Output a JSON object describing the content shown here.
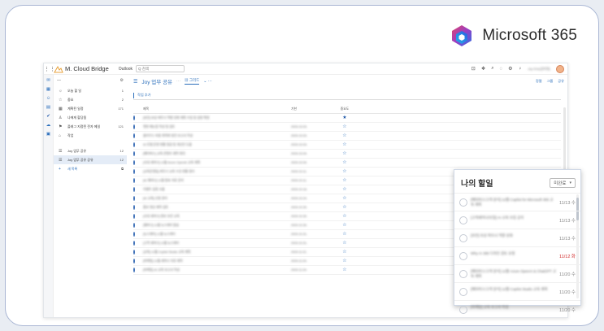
{
  "brand": {
    "name": "Microsoft 365"
  },
  "topbar": {
    "app_name": "M. Cloud Bridge",
    "outlook_label": "Outlook",
    "search_placeholder": "Q 검색",
    "user_name": "Joy Kim(김미정)"
  },
  "sidebar": {
    "items": [
      {
        "icon": "sun-icon",
        "label": "오늘 할 일",
        "count": "1"
      },
      {
        "icon": "star-icon",
        "label": "중요",
        "count": "2"
      },
      {
        "icon": "calendar-icon",
        "label": "계획된 일정",
        "count": "171"
      },
      {
        "icon": "person-icon",
        "label": "나에게 할당됨",
        "count": ""
      },
      {
        "icon": "flag-icon",
        "label": "플래그 지정된 전자 메일",
        "count": "121"
      },
      {
        "icon": "home-icon",
        "label": "작업",
        "count": ""
      }
    ],
    "lists": [
      {
        "icon": "list-icon",
        "label": "Joy 업무 공유",
        "count": "12"
      },
      {
        "icon": "list-icon",
        "label": "Joy 업무 공유 공유",
        "count": "12"
      }
    ],
    "new_list_label": "새 목록"
  },
  "main": {
    "title": "Joy 업무 공유",
    "tab_grid": "그리드",
    "actions": [
      "정렬",
      "그룹",
      "공유"
    ],
    "add_task_label": "작업 추가",
    "columns": {
      "title": "제목",
      "date": "기한",
      "importance": "중요도"
    },
    "rows": [
      {
        "title": "[보안] 보상 파트너 역량 강화 계획 수립 및 일정 확정",
        "date": "",
        "star": true
      },
      {
        "title": "챗봇 매뉴얼 작성 및 검토",
        "date": "2024.10.03.",
        "star": false
      },
      {
        "title": "클라우드 비용 최적화 방안 보고서 작성",
        "date": "2024.10.03.",
        "star": false
      },
      {
        "title": "AI 모델 운영 현황 점검 및 개선안 도출",
        "date": "2024.10.03.",
        "star": false
      },
      {
        "title": "[메타버스] 교육 콘텐츠 제작 회의",
        "date": "2024.10.04.",
        "star": false
      },
      {
        "title": "[사내 세미나] 11월 Azure OpenAI 교육 계획",
        "date": "2024.10.04.",
        "star": false
      },
      {
        "title": "[교육운영팀] 파트너 교육 수강 현황 정리",
        "date": "2024.10.11.",
        "star": false
      },
      {
        "title": "[AI 웨비나] 11월 발표 자료 준비",
        "date": "2024.10.11.",
        "star": false
      },
      {
        "title": "이벤트 일정 조율",
        "date": "2024.10.18.",
        "star": false
      },
      {
        "title": "[AI 교육] 신청 관리",
        "date": "2024.10.24.",
        "star": false
      },
      {
        "title": "홍보 영상 제작 검토",
        "date": "2024.10.30.",
        "star": false
      },
      {
        "title": "[사내 세미나] 정보 보안 교육",
        "date": "2024.10.30.",
        "star": false
      },
      {
        "title": "[웨비나] 11월 뉴스레터 발송",
        "date": "2024.10.30.",
        "star": false
      },
      {
        "title": "[뉴스레터] 11월 뉴스레터",
        "date": "2024.10.31.",
        "star": false
      },
      {
        "title": "[고객 세미나] 11월 뉴스레터",
        "date": "2024.10.31.",
        "star": false
      },
      {
        "title": "[교육] 11월 Copilot Studio 교육 계획",
        "date": "2024.11.01.",
        "star": false
      },
      {
        "title": "[마케팅] 11월 세미나 자료 제작",
        "date": "2024.11.04.",
        "star": false
      },
      {
        "title": "[마케팅] AI 교육 보고서 작성",
        "date": "2024.11.04.",
        "star": false
      }
    ]
  },
  "todo": {
    "title": "나의 할일",
    "filter_label": "미완료",
    "items": [
      {
        "text": "[메타버스/고객 분석] 12월 Copilot for Microsoft 365 교육 계획",
        "due": "11/13 수",
        "overdue": false
      },
      {
        "text": "[고객세미나/모집] AI 교육 모집 공지",
        "due": "11/13 수",
        "overdue": false
      },
      {
        "text": "[보안] 보상 파트너 역량 강화",
        "due": "11/13 수",
        "overdue": false
      },
      {
        "text": "Why AI 365 디자인 검토 요청",
        "due": "11/12 화",
        "overdue": true
      },
      {
        "text": "[메타버스/고객 분석] 12월 Azure OpenAI & ChatGPT 교육 계획",
        "due": "11/20 수",
        "overdue": false
      },
      {
        "text": "[메타버스/고객 분석] 12월 Copilot Studio 교육 계획",
        "due": "11/20 수",
        "overdue": false
      },
      {
        "text": "[마케팅] 교육 보고서 작성",
        "due": "11/20 수",
        "overdue": false
      }
    ]
  },
  "colors": {
    "accent": "#2a6ebb",
    "overdue": "#d12c2c"
  }
}
